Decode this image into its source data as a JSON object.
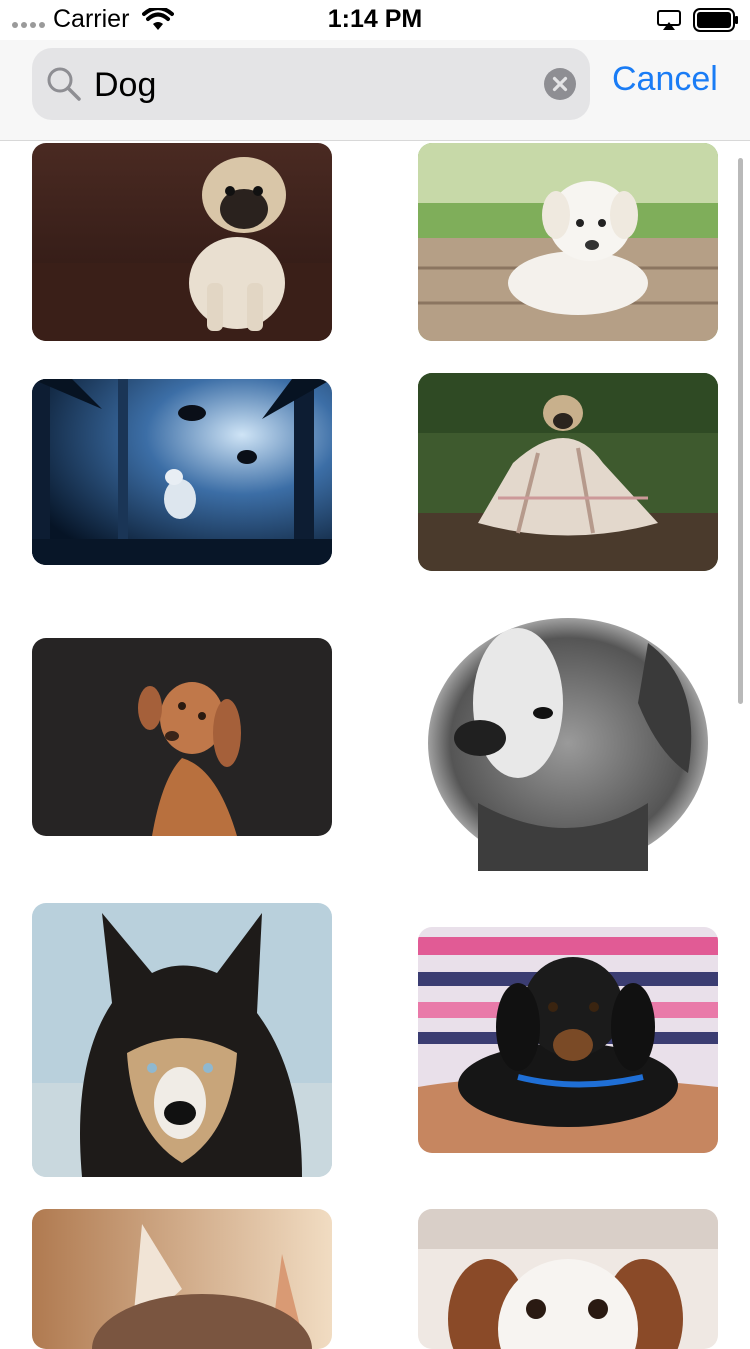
{
  "status_bar": {
    "carrier": "Carrier",
    "time": "1:14 PM",
    "signal_icon": "signal-dots-icon",
    "wifi_icon": "wifi-icon",
    "airplay_icon": "airplay-icon",
    "battery_icon": "battery-icon"
  },
  "search": {
    "query": "Dog",
    "search_icon": "magnifier-icon",
    "clear_icon": "clear-x-icon",
    "cancel_label": "Cancel"
  },
  "colors": {
    "accent": "#1a7cf5",
    "header_bg": "#f7f7f7",
    "field_bg": "#e4e4e6"
  },
  "results": [
    {
      "subject": "pug puppy on wooden floor"
    },
    {
      "subject": "white labrador puppy on wooden deck"
    },
    {
      "subject": "wolves in blue misty forest"
    },
    {
      "subject": "pug wrapped in plaid blanket"
    },
    {
      "subject": "brown dog tilting head"
    },
    {
      "subject": "sketch of puppy head"
    },
    {
      "subject": "husky portrait"
    },
    {
      "subject": "dachshund puppy in arms"
    },
    {
      "subject": "french bulldog"
    },
    {
      "subject": "spaniel puppy"
    }
  ]
}
